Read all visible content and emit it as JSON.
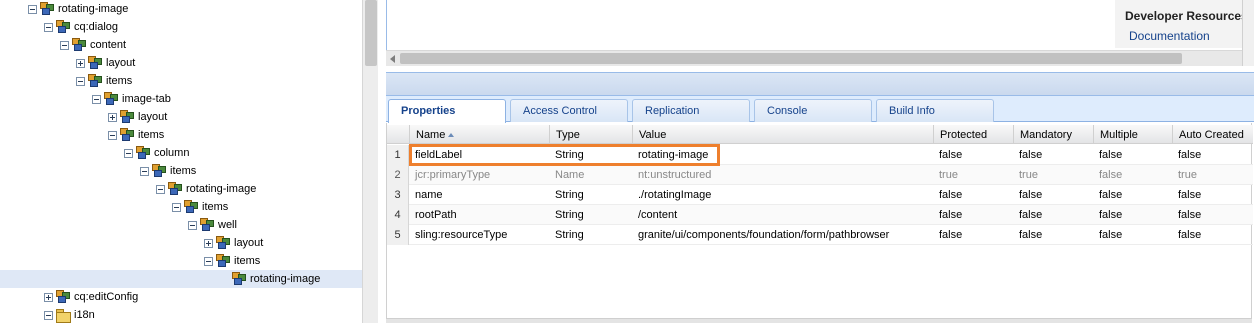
{
  "tree": {
    "nodes": [
      {
        "label": "rotating-image",
        "expander": "minus",
        "icon": "node"
      },
      {
        "label": "cq:dialog",
        "expander": "minus",
        "icon": "node"
      },
      {
        "label": "content",
        "expander": "minus",
        "icon": "node"
      },
      {
        "label": "layout",
        "expander": "plus",
        "icon": "node"
      },
      {
        "label": "items",
        "expander": "minus",
        "icon": "node"
      },
      {
        "label": "image-tab",
        "expander": "minus",
        "icon": "node"
      },
      {
        "label": "layout",
        "expander": "plus",
        "icon": "node"
      },
      {
        "label": "items",
        "expander": "minus",
        "icon": "node"
      },
      {
        "label": "column",
        "expander": "minus",
        "icon": "node"
      },
      {
        "label": "items",
        "expander": "minus",
        "icon": "node"
      },
      {
        "label": "rotating-image",
        "expander": "minus",
        "icon": "node"
      },
      {
        "label": "items",
        "expander": "minus",
        "icon": "node"
      },
      {
        "label": "well",
        "expander": "minus",
        "icon": "node"
      },
      {
        "label": "layout",
        "expander": "plus",
        "icon": "node"
      },
      {
        "label": "items",
        "expander": "minus",
        "icon": "node"
      },
      {
        "label": "rotating-image",
        "expander": "none",
        "icon": "node",
        "selected": true
      },
      {
        "label": "cq:editConfig",
        "expander": "plus",
        "icon": "node"
      },
      {
        "label": "i18n",
        "expander": "minus",
        "icon": "folder"
      }
    ]
  },
  "developer_resources": {
    "title": "Developer Resources",
    "link": "Documentation"
  },
  "tabs": [
    "Properties",
    "Access Control",
    "Replication",
    "Console",
    "Build Info"
  ],
  "active_tab": "Properties",
  "grid": {
    "columns": [
      "Name",
      "Type",
      "Value",
      "Protected",
      "Mandatory",
      "Multiple",
      "Auto Created"
    ],
    "sorted_column": "Name",
    "sort_direction": "ascending",
    "rows": [
      {
        "num": "1",
        "name": "fieldLabel",
        "type": "String",
        "value": "rotating-image",
        "protected": "false",
        "mandatory": "false",
        "multiple": "false",
        "auto": "false",
        "highlighted": true
      },
      {
        "num": "2",
        "name": "jcr:primaryType",
        "type": "Name",
        "value": "nt:unstructured",
        "protected": "true",
        "mandatory": "true",
        "multiple": "false",
        "auto": "true",
        "dimmed": true
      },
      {
        "num": "3",
        "name": "name",
        "type": "String",
        "value": "./rotatingImage",
        "protected": "false",
        "mandatory": "false",
        "multiple": "false",
        "auto": "false"
      },
      {
        "num": "4",
        "name": "rootPath",
        "type": "String",
        "value": "/content",
        "protected": "false",
        "mandatory": "false",
        "multiple": "false",
        "auto": "false"
      },
      {
        "num": "5",
        "name": "sling:resourceType",
        "type": "String",
        "value": "granite/ui/components/foundation/form/pathbrowser",
        "protected": "false",
        "mandatory": "false",
        "multiple": "false",
        "auto": "false"
      }
    ]
  },
  "colors": {
    "highlight_border": "#ee7f2d",
    "tab_text": "#15428b",
    "selected_tree_row": "#dfe8f6"
  }
}
